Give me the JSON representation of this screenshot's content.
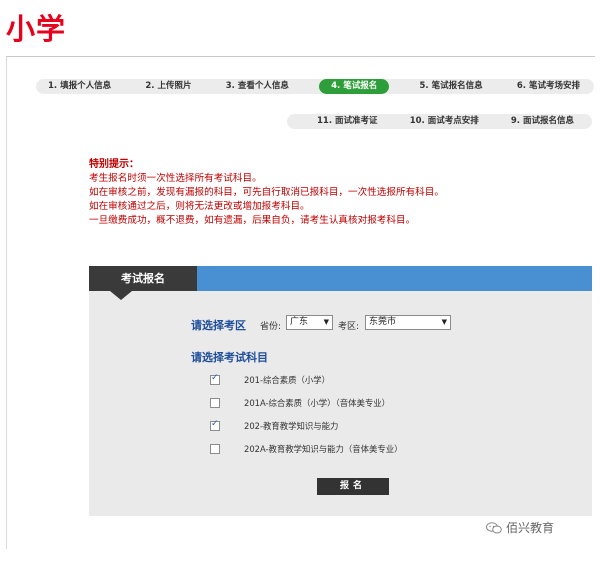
{
  "page_title": "小学",
  "steps_row1": [
    {
      "label": "1. 填报个人信息",
      "active": false
    },
    {
      "label": "2. 上传照片",
      "active": false
    },
    {
      "label": "3. 查看个人信息",
      "active": false
    },
    {
      "label": "4. 笔试报名",
      "active": true
    },
    {
      "label": "5. 笔试报名信息",
      "active": false
    },
    {
      "label": "6. 笔试考场安排",
      "active": false
    }
  ],
  "steps_row2": [
    {
      "label": "11. 面试准考证",
      "active": false
    },
    {
      "label": "10. 面试考点安排",
      "active": false
    },
    {
      "label": "9. 面试报名信息",
      "active": false
    }
  ],
  "notice": {
    "title": "特别提示：",
    "lines": [
      "考生报名时须一次性选择所有考试科目。",
      "如在审核之前，发现有漏报的科目，可先自行取消已报科目，一次性选报所有科目。",
      "如在审核通过之后，则将无法更改或增加报考科目。",
      "一旦缴费成功，概不退费，如有遗漏，后果自负，请考生认真核对报考科目。"
    ]
  },
  "form": {
    "tab_label": "考试报名",
    "region_label": "请选择考区",
    "province_label": "省份:",
    "province_value": "广东",
    "district_label": "考区:",
    "district_value": "东莞市",
    "subjects_label": "请选择考试科目",
    "subjects": [
      {
        "label": "201-综合素质（小学）",
        "checked": true
      },
      {
        "label": "201A-综合素质（小学）（音体美专业）",
        "checked": false
      },
      {
        "label": "202-教育教学知识与能力",
        "checked": true
      },
      {
        "label": "202A-教育教学知识与能力（音体美专业）",
        "checked": false
      }
    ],
    "submit_label": "报名"
  },
  "watermark": {
    "text": "佰兴教育",
    "icon": "wechat-icon"
  },
  "colors": {
    "active_step": "#2e9e3b",
    "notice": "#c00000",
    "panel_header": "#4990d2",
    "tab_dark": "#3a3a3a"
  }
}
